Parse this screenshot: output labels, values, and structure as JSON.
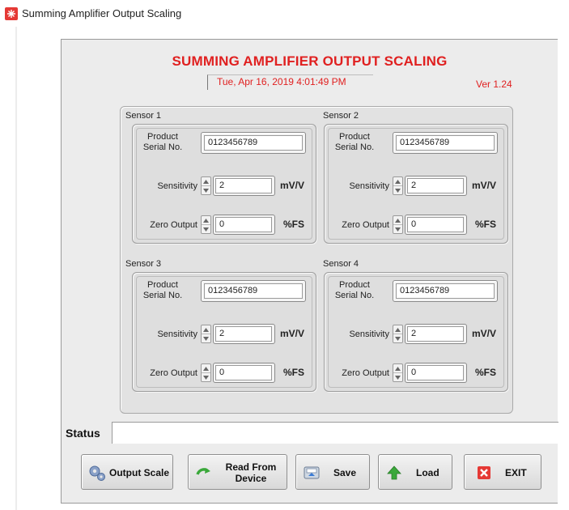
{
  "window": {
    "title": "Summing Amplifier Output Scaling"
  },
  "header": {
    "title": "SUMMING AMPLIFIER  OUTPUT SCALING",
    "datetime": "Tue, Apr 16, 2019 4:01:49 PM",
    "version": "Ver 1.24"
  },
  "labels": {
    "product_serial_line1": "Product",
    "product_serial_line2": "Serial No.",
    "sensitivity": "Sensitivity",
    "zero_output": "Zero Output",
    "sensitivity_unit": "mV/V",
    "zero_unit": "%FS"
  },
  "sensors": [
    {
      "name": "Sensor 1",
      "serial": "0123456789",
      "sensitivity": "2",
      "zero_output": "0"
    },
    {
      "name": "Sensor 2",
      "serial": "0123456789",
      "sensitivity": "2",
      "zero_output": "0"
    },
    {
      "name": "Sensor 3",
      "serial": "0123456789",
      "sensitivity": "2",
      "zero_output": "0"
    },
    {
      "name": "Sensor 4",
      "serial": "0123456789",
      "sensitivity": "2",
      "zero_output": "0"
    }
  ],
  "status": {
    "label": "Status",
    "value": ""
  },
  "buttons": {
    "output_scale": "Output Scale",
    "read_line1": "Read From",
    "read_line2": "Device",
    "save": "Save",
    "load": "Load",
    "exit": "EXIT"
  },
  "icons": {
    "app": "app-icon",
    "output_scale": "gears-icon",
    "read": "green-arrow-refresh-icon",
    "save": "save-disk-icon",
    "load": "green-up-arrow-icon",
    "exit": "red-x-icon"
  },
  "colors": {
    "accent_red": "#e02020",
    "panel_bg": "#ececec",
    "green": "#3aa83a"
  }
}
